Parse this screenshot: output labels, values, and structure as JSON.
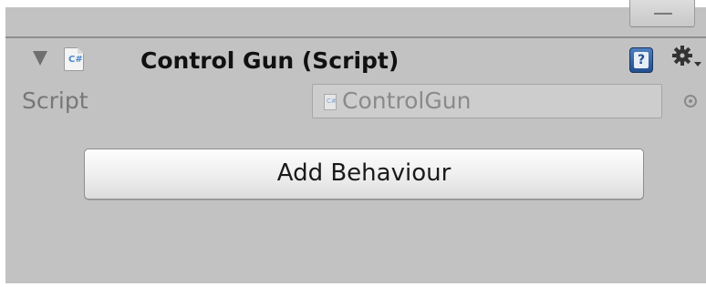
{
  "component": {
    "title": "Control Gun (Script)",
    "icon": "csharp-script-icon",
    "expanded": true,
    "help_icon": "help-book-icon",
    "settings_icon": "gear-icon",
    "collapse_tab_icon": "minus-icon"
  },
  "fields": {
    "script_label": "Script",
    "script_value": "ControlGun",
    "object_picker_icon": "object-picker-icon"
  },
  "actions": {
    "add_behaviour_label": "Add Behaviour"
  },
  "colors": {
    "panel_background": "#c2c2c2",
    "help_icon_blue": "#234f8e"
  }
}
